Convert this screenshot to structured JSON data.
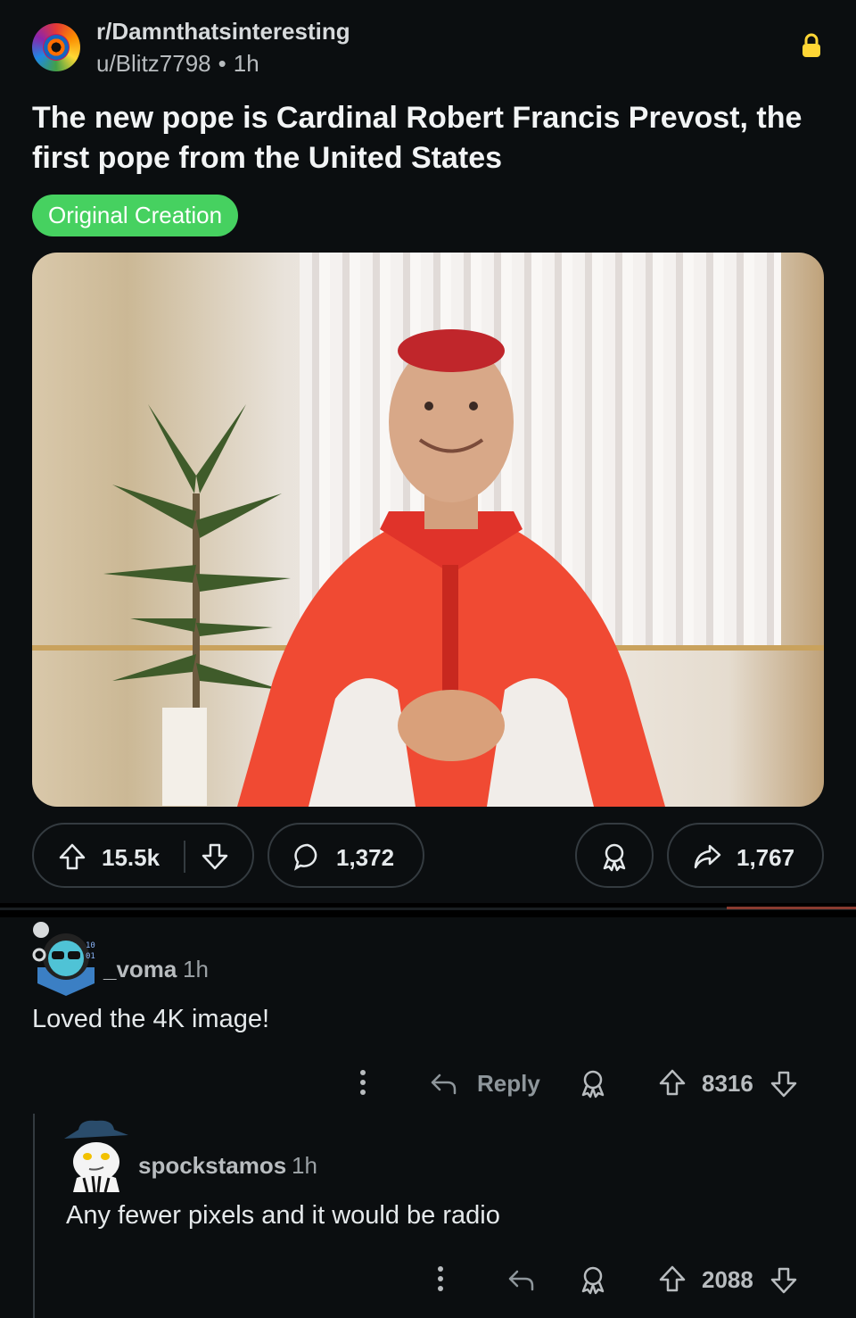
{
  "post": {
    "subreddit": "r/Damnthatsinteresting",
    "author": "u/Blitz7798",
    "time": "1h",
    "title": "The new pope is Cardinal Robert Francis Prevost, the first pope from the United States",
    "flair": "Original Creation",
    "image_alt": "Cardinal in red vestments smiling",
    "votes": "15.5k",
    "comments": "1,372",
    "shares": "1,767"
  },
  "comments": [
    {
      "author": "_voma",
      "time": "1h",
      "body": "Loved the 4K image!",
      "reply_label": "Reply",
      "votes": "8316"
    },
    {
      "author": "spockstamos",
      "time": "1h",
      "body": "Any fewer pixels and it would be radio",
      "votes": "2088"
    }
  ],
  "colors": {
    "background": "#0b0e10",
    "flair": "#46d160",
    "lock": "#ffd635",
    "border": "#343b40"
  },
  "icons": [
    "lock-icon",
    "upvote-icon",
    "downvote-icon",
    "comment-icon",
    "award-icon",
    "share-icon",
    "more-icon",
    "reply-icon"
  ]
}
